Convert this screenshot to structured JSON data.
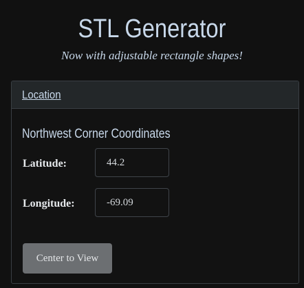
{
  "header": {
    "title": "STL Generator",
    "subtitle": "Now with adjustable rectangle shapes!"
  },
  "location_panel": {
    "header_link": "Location",
    "section_heading": "Northwest Corner Coordinates",
    "latitude": {
      "label": "Latitude:",
      "value": "44.2"
    },
    "longitude": {
      "label": "Longitude:",
      "value": "-69.09"
    },
    "center_button_label": "Center to View"
  },
  "colors": {
    "background": "#111111",
    "title_text": "#c8d8ea",
    "panel_header_bg": "#232729",
    "panel_border": "#3a3f44",
    "button_bg": "#6c6f72"
  }
}
